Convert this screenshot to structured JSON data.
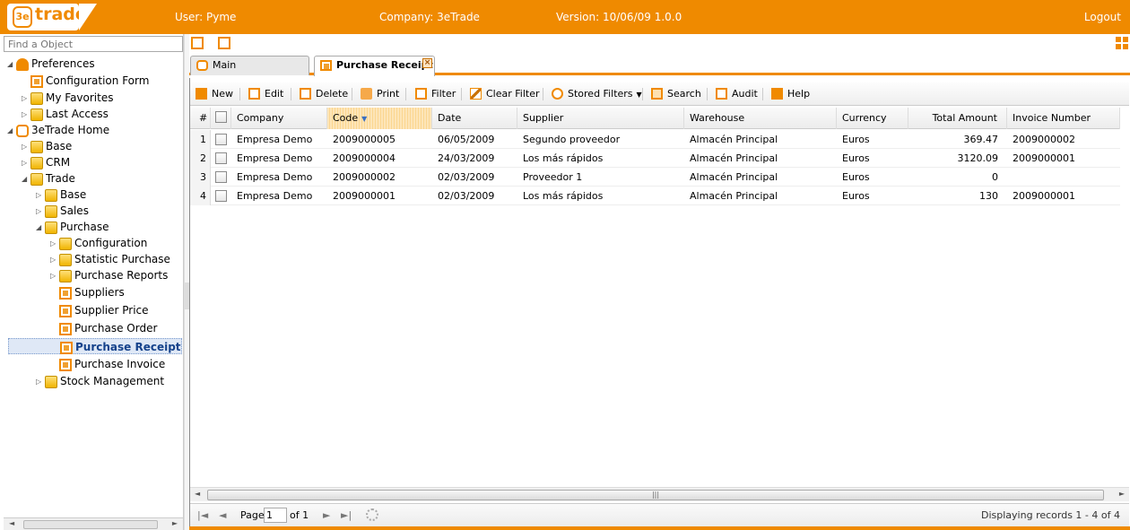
{
  "app": {
    "logo_text": "trade",
    "logo_mark": "3e",
    "user": "User: Pyme",
    "company": "Company: 3eTrade",
    "version": "Version: 10/06/09 1.0.0",
    "logout": "Logout"
  },
  "sidebar": {
    "search_placeholder": "Find a Object",
    "tree": [
      {
        "label": "Preferences",
        "icon": "preferences-icon"
      },
      {
        "label": "Configuration Form",
        "icon": "form-icon"
      },
      {
        "label": "My Favorites",
        "icon": "folder-icon"
      },
      {
        "label": "Last Access",
        "icon": "folder-icon"
      },
      {
        "label": "3eTrade Home",
        "icon": "home-icon"
      },
      {
        "label": "Base",
        "icon": "folder-icon"
      },
      {
        "label": "CRM",
        "icon": "folder-icon"
      },
      {
        "label": "Trade",
        "icon": "folder-icon"
      },
      {
        "label": "Base",
        "icon": "folder-icon"
      },
      {
        "label": "Sales",
        "icon": "folder-icon"
      },
      {
        "label": "Purchase",
        "icon": "folder-icon"
      },
      {
        "label": "Configuration",
        "icon": "folder-icon"
      },
      {
        "label": "Statistic Purchase",
        "icon": "folder-icon"
      },
      {
        "label": "Purchase Reports",
        "icon": "folder-icon"
      },
      {
        "label": "Suppliers",
        "icon": "form-icon"
      },
      {
        "label": "Supplier Price",
        "icon": "form-icon"
      },
      {
        "label": "Purchase Order",
        "icon": "form-icon"
      },
      {
        "label": "Purchase Receipt",
        "icon": "form-icon",
        "selected": true
      },
      {
        "label": "Purchase Invoice",
        "icon": "form-icon"
      },
      {
        "label": "Stock Management",
        "icon": "folder-icon"
      }
    ]
  },
  "tabs": [
    {
      "label": "Main",
      "active": false
    },
    {
      "label": "Purchase Receipt",
      "active": true
    }
  ],
  "toolbar": {
    "new": "New",
    "edit": "Edit",
    "delete": "Delete",
    "print": "Print",
    "filter": "Filter",
    "clear_filter": "Clear Filter",
    "stored_filters": "Stored Filters",
    "search": "Search",
    "audit": "Audit",
    "help": "Help"
  },
  "grid": {
    "columns": [
      "#",
      "Company",
      "Code",
      "Date",
      "Supplier",
      "Warehouse",
      "Currency",
      "Total Amount",
      "Invoice Number"
    ],
    "sorted_column": "Code",
    "rows": [
      {
        "n": "1",
        "company": "Empresa Demo",
        "code": "2009000005",
        "date": "06/05/2009",
        "supplier": "Segundo proveedor",
        "warehouse": "Almacén Principal",
        "currency": "Euros",
        "total": "369.47",
        "invoice": "2009000002"
      },
      {
        "n": "2",
        "company": "Empresa Demo",
        "code": "2009000004",
        "date": "24/03/2009",
        "supplier": "Los más rápidos",
        "warehouse": "Almacén Principal",
        "currency": "Euros",
        "total": "3120.09",
        "invoice": "2009000001"
      },
      {
        "n": "3",
        "company": "Empresa Demo",
        "code": "2009000002",
        "date": "02/03/2009",
        "supplier": "Proveedor 1",
        "warehouse": "Almacén Principal",
        "currency": "Euros",
        "total": "0",
        "invoice": ""
      },
      {
        "n": "4",
        "company": "Empresa Demo",
        "code": "2009000001",
        "date": "02/03/2009",
        "supplier": "Los más rápidos",
        "warehouse": "Almacén Principal",
        "currency": "Euros",
        "total": "130",
        "invoice": "2009000001"
      }
    ]
  },
  "pager": {
    "page_label": "Page",
    "page_value": "1",
    "of_label": "of 1",
    "displaying": "Displaying records 1 - 4 of 4"
  },
  "colors": {
    "accent": "#ef8a00",
    "selection": "#dfe8f6"
  }
}
